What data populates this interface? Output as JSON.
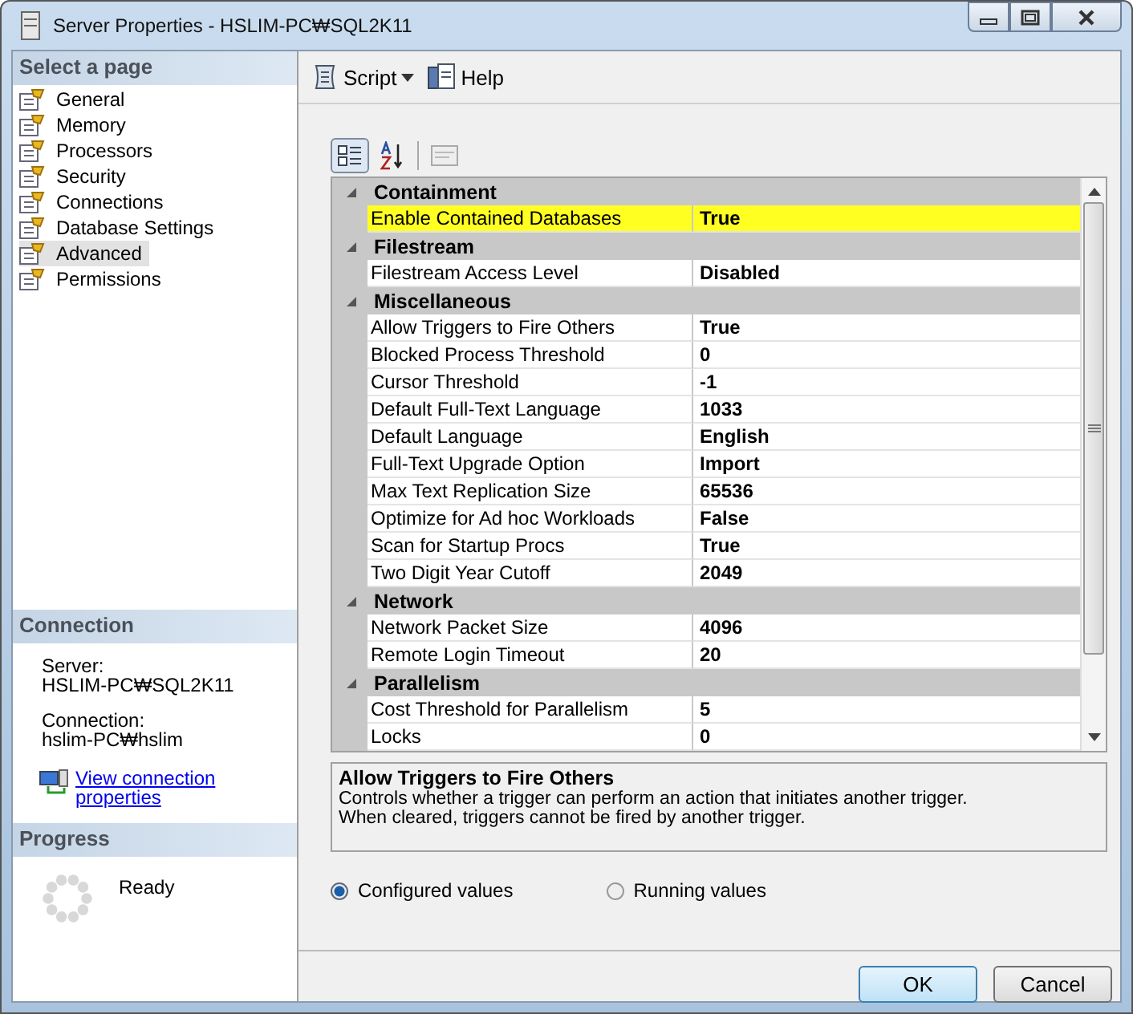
{
  "window": {
    "title": "Server Properties - HSLIM-PC₩SQL2K11"
  },
  "sidebar": {
    "header": "Select a page",
    "pages": [
      {
        "label": "General",
        "selected": false
      },
      {
        "label": "Memory",
        "selected": false
      },
      {
        "label": "Processors",
        "selected": false
      },
      {
        "label": "Security",
        "selected": false
      },
      {
        "label": "Connections",
        "selected": false
      },
      {
        "label": "Database Settings",
        "selected": false
      },
      {
        "label": "Advanced",
        "selected": true
      },
      {
        "label": "Permissions",
        "selected": false
      }
    ]
  },
  "connection": {
    "header": "Connection",
    "server_label": "Server:",
    "server": "HSLIM-PC₩SQL2K11",
    "connection_label": "Connection:",
    "connection": "hslim-PC₩hslim",
    "link": "View connection properties"
  },
  "progress": {
    "header": "Progress",
    "status": "Ready"
  },
  "toolbar": [
    {
      "label": "Script",
      "kind": "script"
    },
    {
      "label": "Help",
      "kind": "help"
    }
  ],
  "grid": {
    "categories": [
      {
        "name": "Containment",
        "expanded": true,
        "properties": [
          {
            "name": "Enable Contained Databases",
            "value": "True",
            "highlighted": true
          }
        ]
      },
      {
        "name": "Filestream",
        "expanded": true,
        "properties": [
          {
            "name": "Filestream Access Level",
            "value": "Disabled",
            "highlighted": false
          }
        ]
      },
      {
        "name": "Miscellaneous",
        "expanded": true,
        "properties": [
          {
            "name": "Allow Triggers to Fire Others",
            "value": "True",
            "highlighted": false
          },
          {
            "name": "Blocked Process Threshold",
            "value": "0",
            "highlighted": false
          },
          {
            "name": "Cursor Threshold",
            "value": "-1",
            "highlighted": false
          },
          {
            "name": "Default Full-Text Language",
            "value": "1033",
            "highlighted": false
          },
          {
            "name": "Default Language",
            "value": "English",
            "highlighted": false
          },
          {
            "name": "Full-Text Upgrade Option",
            "value": "Import",
            "highlighted": false
          },
          {
            "name": "Max Text Replication Size",
            "value": "65536",
            "highlighted": false
          },
          {
            "name": "Optimize for Ad hoc Workloads",
            "value": "False",
            "highlighted": false
          },
          {
            "name": "Scan for Startup Procs",
            "value": "True",
            "highlighted": false
          },
          {
            "name": "Two Digit Year Cutoff",
            "value": "2049",
            "highlighted": false
          }
        ]
      },
      {
        "name": "Network",
        "expanded": true,
        "properties": [
          {
            "name": "Network Packet Size",
            "value": "4096",
            "highlighted": false
          },
          {
            "name": "Remote Login Timeout",
            "value": "20",
            "highlighted": false
          }
        ]
      },
      {
        "name": "Parallelism",
        "expanded": true,
        "properties": [
          {
            "name": "Cost Threshold for Parallelism",
            "value": "5",
            "highlighted": false
          },
          {
            "name": "Locks",
            "value": "0",
            "highlighted": false
          }
        ]
      }
    ]
  },
  "description": {
    "title": "Allow Triggers to Fire Others",
    "text": "Controls whether a trigger can perform an action that initiates another trigger. When cleared, triggers cannot be fired by another trigger."
  },
  "radios": [
    {
      "label": "Configured values",
      "selected": true
    },
    {
      "label": "Running values",
      "selected": false
    }
  ],
  "buttons": [
    {
      "label": "OK",
      "default": true
    },
    {
      "label": "Cancel",
      "default": false
    }
  ]
}
